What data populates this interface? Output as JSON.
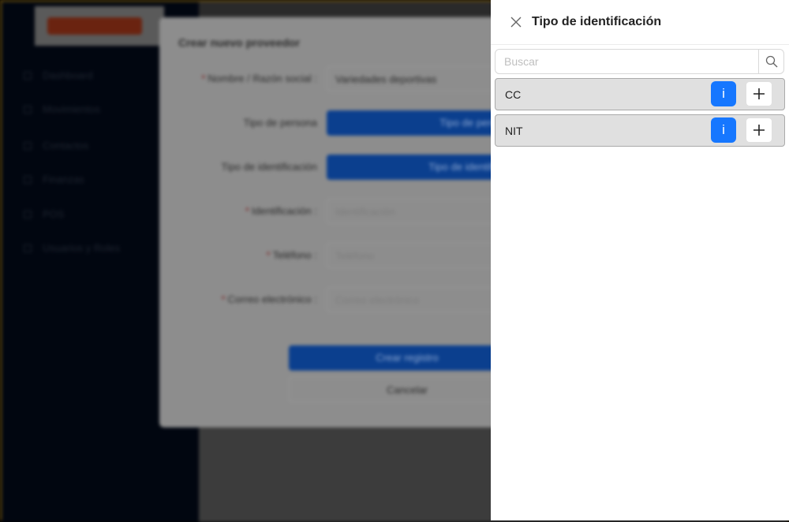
{
  "background": {
    "sidebar": {
      "items": [
        "Dashboard",
        "Movimientos",
        "Contactos",
        "Finanzas",
        "POS",
        "Usuarios y Roles"
      ]
    },
    "modal": {
      "title": "Crear nuevo proveedor",
      "fields": [
        {
          "label": "Nombre / Razón social",
          "value": "Variedades deportivas"
        },
        {
          "label": "Tipo de persona",
          "button": "Tipo de persona"
        },
        {
          "label": "Tipo de identificación",
          "button": "Tipo de identificación"
        },
        {
          "label": "Identificación",
          "placeholder": "Identificación"
        },
        {
          "label": "Teléfono",
          "placeholder": "Teléfono"
        },
        {
          "label": "Correo electrónico",
          "placeholder": "Correo electrónico"
        }
      ],
      "required_mark": "*",
      "create_label": "Crear registro",
      "cancel_label": "Cancelar"
    }
  },
  "drawer": {
    "title": "Tipo de identificación",
    "search_placeholder": "Buscar",
    "items": [
      {
        "label": "CC"
      },
      {
        "label": "NIT"
      }
    ],
    "info_label": "i",
    "accent": "#1677ff"
  }
}
